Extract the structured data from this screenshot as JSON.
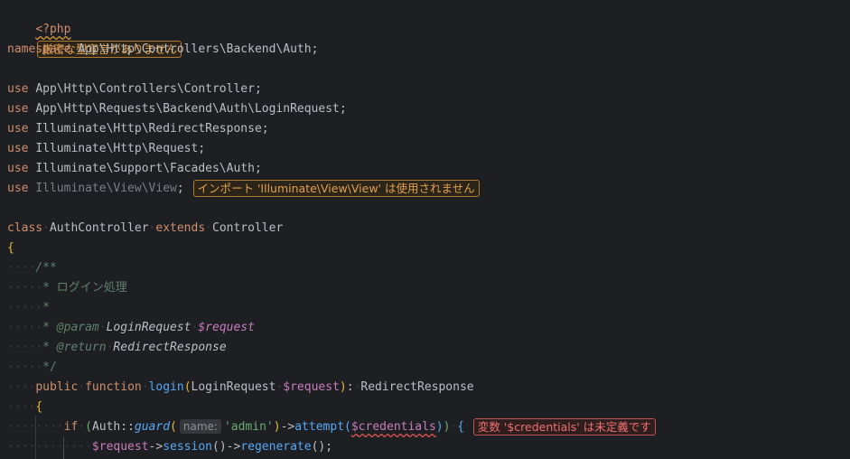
{
  "editor": {
    "php_open_tag": "<?php",
    "strict_types_warning": "厳密な型宣言がありません",
    "namespace_kw": "namespace",
    "namespace_name": "App\\Http\\Controllers\\Backend\\Auth",
    "use_kw": "use",
    "uses": [
      "App\\Http\\Controllers\\Controller",
      "App\\Http\\Requests\\Backend\\Auth\\LoginRequest",
      "Illuminate\\Http\\RedirectResponse",
      "Illuminate\\Http\\Request",
      "Illuminate\\Support\\Facades\\Auth"
    ],
    "unused_use": "Illuminate\\View\\View",
    "unused_import_warning": "インポート 'Illuminate\\View\\View' は使用されません",
    "class_kw": "class",
    "class_name": "AuthController",
    "extends_kw": "extends",
    "parent_class": "Controller",
    "open_brace": "{",
    "doc_open": "/**",
    "doc_summary": "* ログイン処理",
    "doc_empty": "*",
    "doc_param_tag": "@param",
    "doc_param_type": "LoginRequest",
    "doc_param_var": "$request",
    "doc_return_tag": "@return",
    "doc_return_type": "RedirectResponse",
    "doc_close": "*/",
    "public_kw": "public",
    "function_kw": "function",
    "method_name": "login",
    "param_type": "LoginRequest",
    "param_var": "$request",
    "return_type": "RedirectResponse",
    "if_kw": "if",
    "auth_class": "Auth",
    "guard_method": "guard",
    "param_hint": "name:",
    "guard_arg": "'admin'",
    "attempt_method": "attempt",
    "credentials_var": "$credentials",
    "undefined_var_error": "変数 '$credentials' は未定義です",
    "request_var": "$request",
    "session_method": "session",
    "regenerate_method": "regenerate"
  },
  "colors": {
    "background": "#1e1f22",
    "keyword": "#cf8e6d",
    "function": "#56a8f5",
    "variable": "#c77dbb",
    "string": "#6aab73",
    "doc_comment": "#5f826b",
    "warning": "#e0a050",
    "error": "#f07070"
  }
}
